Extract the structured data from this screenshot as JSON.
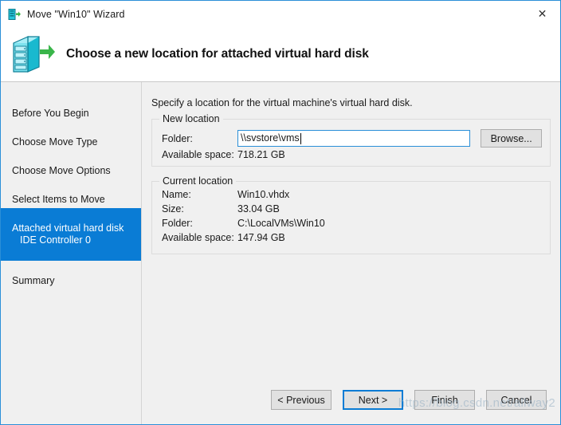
{
  "window": {
    "title": "Move \"Win10\" Wizard",
    "title_icon": "server-move-icon",
    "close_icon": "✕",
    "accent_color": "#0a7cd5",
    "border_color": "#2a8fd8",
    "body_color": "#f0f0f0"
  },
  "header": {
    "icon": "server-arrow-icon",
    "title": "Choose a new location for attached virtual hard disk"
  },
  "sidebar": {
    "items": [
      {
        "label": "Before You Begin",
        "sub": "",
        "selected": false
      },
      {
        "label": "Choose Move Type",
        "sub": "",
        "selected": false
      },
      {
        "label": "Choose Move Options",
        "sub": "",
        "selected": false
      },
      {
        "label": "Select Items to Move",
        "sub": "",
        "selected": false
      },
      {
        "label": "Attached virtual hard disk",
        "sub": "IDE Controller 0",
        "selected": true
      },
      {
        "label": "Summary",
        "sub": "",
        "selected": false
      }
    ]
  },
  "content": {
    "intro": "Specify a location for the virtual machine's virtual hard disk.",
    "new_location": {
      "legend": "New location",
      "folder_label": "Folder:",
      "folder_value": "\\\\svstore\\vms",
      "folder_placeholder": "",
      "browse_label": "Browse...",
      "available_label": "Available space:",
      "available_value": "718.21 GB"
    },
    "current_location": {
      "legend": "Current location",
      "rows": [
        {
          "label": "Name:",
          "value": "Win10.vhdx"
        },
        {
          "label": "Size:",
          "value": "33.04 GB"
        },
        {
          "label": "Folder:",
          "value": "C:\\LocalVMs\\Win10"
        },
        {
          "label": "Available space:",
          "value": "147.94 GB"
        }
      ]
    }
  },
  "footer": {
    "buttons": [
      {
        "label": "< Previous",
        "focused": false
      },
      {
        "label": "Next >",
        "focused": true
      },
      {
        "label": "Finish",
        "focused": false
      },
      {
        "label": "Cancel",
        "focused": false
      }
    ]
  },
  "watermark": {
    "text": "https://blog.csdn.net/allway2"
  }
}
